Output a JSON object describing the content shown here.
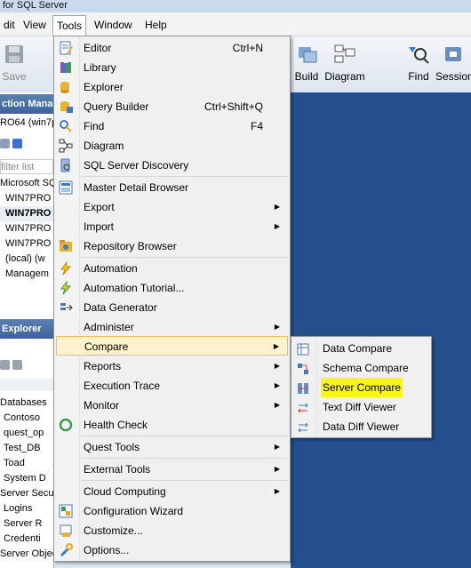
{
  "window": {
    "title": "for SQL Server"
  },
  "menubar": {
    "items": [
      "dit",
      "View",
      "Tools",
      "Window",
      "Help"
    ]
  },
  "toolbar": {
    "save": "Save",
    "build": "Build",
    "diagram": "Diagram",
    "find": "Find",
    "session": "Session"
  },
  "left_pane": {
    "connection_header": "ction Mana",
    "server_label": "RO64 (win7p",
    "filter_placeholder": "filter list",
    "items": [
      "Microsoft SQ",
      "WIN7PRO",
      "WIN7PRO",
      "WIN7PRO",
      "WIN7PRO",
      "(local) (w",
      "Managem"
    ],
    "explorer_header": "Explorer",
    "explorer_items": [
      "Databases",
      "Contoso",
      "quest_op",
      "Test_DB",
      "Toad",
      "System D",
      "Server Secu",
      "Logins",
      "Server R",
      "Credenti",
      "Server Objec"
    ]
  },
  "tools_menu": {
    "items": [
      {
        "label": "Editor",
        "shortcut": "Ctrl+N",
        "icon": "editor-icon"
      },
      {
        "label": "Library",
        "icon": "library-icon"
      },
      {
        "label": "Explorer",
        "icon": "explorer-icon"
      },
      {
        "label": "Query Builder",
        "shortcut": "Ctrl+Shift+Q",
        "icon": "query-builder-icon"
      },
      {
        "label": "Find",
        "shortcut": "F4",
        "icon": "find-icon"
      },
      {
        "label": "Diagram",
        "icon": "diagram-icon"
      },
      {
        "label": "SQL Server Discovery",
        "icon": "discovery-icon"
      },
      {
        "label": "Master Detail Browser",
        "icon": "master-detail-icon"
      },
      {
        "label": "Export",
        "submenu": true
      },
      {
        "label": "Import",
        "submenu": true
      },
      {
        "label": "Repository Browser",
        "icon": "repository-icon"
      },
      {
        "label": "Automation",
        "icon": "automation-icon"
      },
      {
        "label": "Automation Tutorial...",
        "icon": "automation-tutorial-icon"
      },
      {
        "label": "Data Generator",
        "icon": "data-generator-icon"
      },
      {
        "label": "Administer",
        "submenu": true
      },
      {
        "label": "Compare",
        "submenu": true
      },
      {
        "label": "Reports",
        "submenu": true
      },
      {
        "label": "Execution Trace",
        "submenu": true
      },
      {
        "label": "Monitor",
        "submenu": true
      },
      {
        "label": "Health Check",
        "icon": "health-check-icon"
      },
      {
        "label": "Quest Tools",
        "submenu": true
      },
      {
        "label": "External Tools",
        "submenu": true
      },
      {
        "label": "Cloud Computing",
        "submenu": true
      },
      {
        "label": "Configuration Wizard",
        "icon": "config-wizard-icon"
      },
      {
        "label": "Customize...",
        "icon": "customize-icon"
      },
      {
        "label": "Options...",
        "icon": "options-icon"
      }
    ]
  },
  "compare_submenu": {
    "items": [
      "Data Compare",
      "Schema Compare",
      "Server Compare",
      "Text Diff Viewer",
      "Data Diff Viewer"
    ],
    "highlighted": "Server Compare",
    "highlight_color": "#f7f51c"
  },
  "colors": {
    "menu_hover": "#fff2cc",
    "desktop": "#254e8d"
  }
}
